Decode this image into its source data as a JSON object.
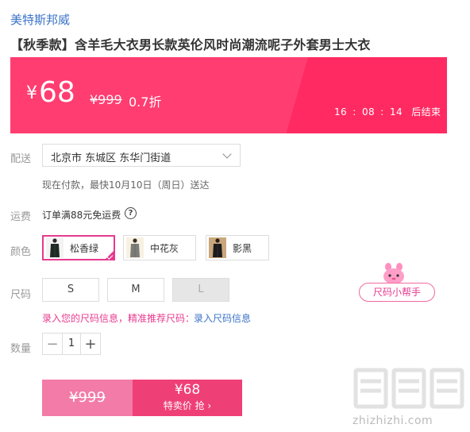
{
  "brand": "美特斯邦威",
  "product_title": "【秋季款】含羊毛大衣男长款英伦风时尚潮流呢子外套男士大衣",
  "banner": {
    "currency": "¥",
    "price": "68",
    "original_price": "¥999",
    "discount": "0.7折",
    "countdown": {
      "h": "16",
      "sep1": ":",
      "m": "08",
      "sep2": ":",
      "s": "14",
      "suffix": "后结束"
    },
    "colors": {
      "base": "#ff3d71",
      "stripe": "#ff2a62"
    }
  },
  "shipping": {
    "label": "配送",
    "address": "北京市 东城区 东华门街道",
    "delivery_note": "现在付款，最快10月10日（周日）送达"
  },
  "fee": {
    "label": "运费",
    "text": "订单满88元免运费",
    "help_icon": "?"
  },
  "color": {
    "label": "颜色",
    "options": [
      {
        "name": "松香绿",
        "selected": true
      },
      {
        "name": "中花灰",
        "selected": false
      },
      {
        "name": "影黑",
        "selected": false
      }
    ]
  },
  "size": {
    "label": "尺码",
    "options": [
      {
        "name": "S",
        "available": true
      },
      {
        "name": "M",
        "available": true
      },
      {
        "name": "L",
        "available": false
      }
    ],
    "helper": "尺码小帮手",
    "note": "录入您的尺码信息，精准推荐尺码：",
    "link": "录入尺码信息"
  },
  "quantity": {
    "label": "数量",
    "value": "1",
    "minus": "−",
    "plus": "+"
  },
  "buy": {
    "original_price": "¥999",
    "price": "¥68",
    "action": "特卖价 抢 ›"
  },
  "watermark": {
    "logo": "值值值",
    "site": "zhizhizhi.com"
  },
  "accent_colors": {
    "pink": "#e73a8e",
    "link": "#3b73c8"
  }
}
